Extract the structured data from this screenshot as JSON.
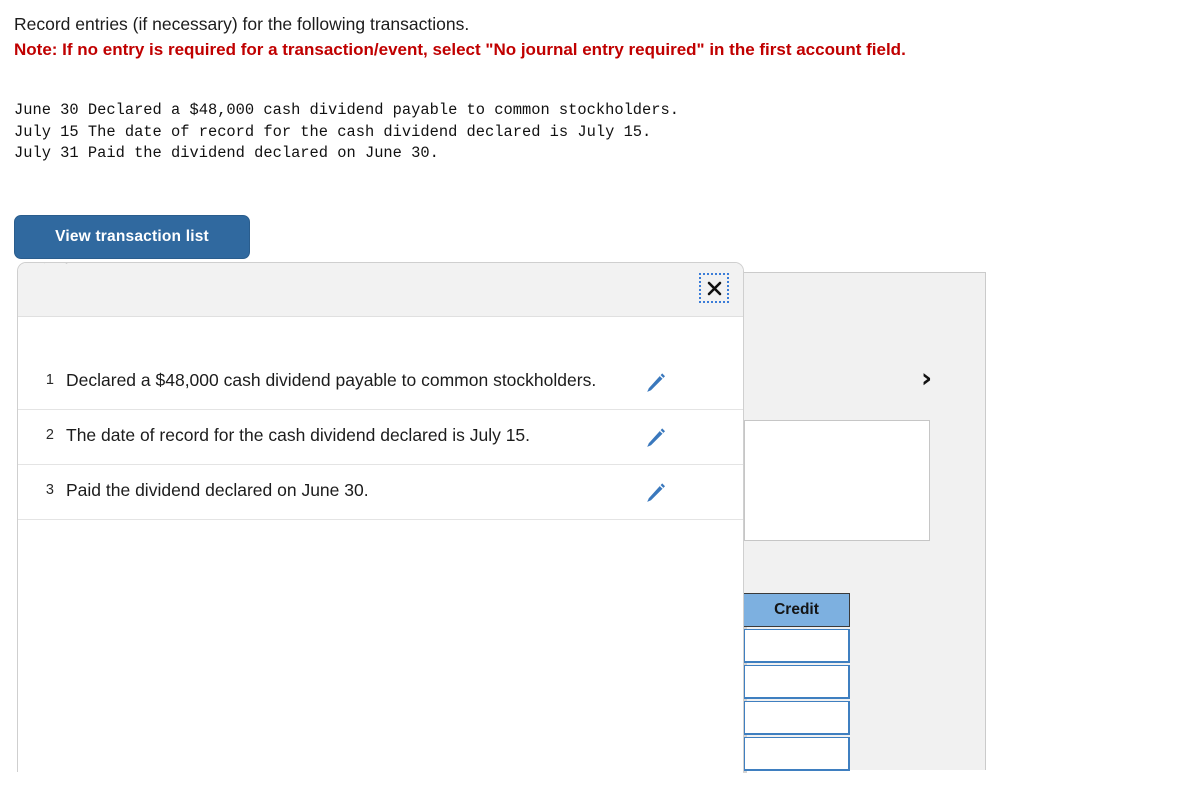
{
  "instructions": {
    "line1": "Record entries (if necessary) for the following transactions.",
    "note": "Note: If no entry is required for a transaction/event, select \"No journal entry required\" in the first account field."
  },
  "transactions_text": [
    "June 30 Declared a $48,000 cash dividend payable to common stockholders.",
    "July 15 The date of record for the cash dividend declared is July 15.",
    "July 31 Paid the dividend declared on June 30."
  ],
  "buttons": {
    "view_transaction_list": "View transaction list"
  },
  "popup": {
    "close_icon": "close-icon",
    "rows": [
      {
        "num": "1",
        "desc": "Declared a $48,000 cash dividend payable to common stockholders.",
        "edit_icon": "pencil-icon"
      },
      {
        "num": "2",
        "desc": "The date of record for the cash dividend declared is July 15.",
        "edit_icon": "pencil-icon"
      },
      {
        "num": "3",
        "desc": "Paid the dividend declared on June 30.",
        "edit_icon": "pencil-icon"
      }
    ]
  },
  "journal": {
    "next_chevron": "›",
    "credit_header": "Credit",
    "credit_cells": [
      "",
      "",
      "",
      ""
    ]
  },
  "colors": {
    "button_blue": "#30699f",
    "note_red": "#c00000",
    "pencil_blue": "#3a78bd",
    "credit_header_blue": "#7db0e0",
    "cell_border_blue": "#3f7fc0",
    "panel_gray": "#f1f1f1"
  }
}
